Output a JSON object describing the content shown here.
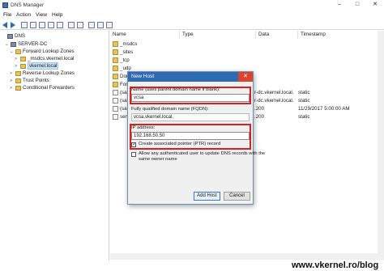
{
  "titlebar": {
    "title": "DNS Manager",
    "minimize": "–",
    "maximize": "□",
    "close": "✕"
  },
  "menu": [
    "File",
    "Action",
    "View",
    "Help"
  ],
  "tree": [
    {
      "label": "DNS",
      "expander": "",
      "icon": "dns-icon"
    },
    {
      "label": "SERVER-DC",
      "expander": "⌄",
      "icon": "server-icon"
    },
    {
      "label": "Forward Lookup Zones",
      "expander": "⌄",
      "icon": "folder-icon"
    },
    {
      "label": "_msdcs.vkernel.local",
      "expander": ">",
      "icon": "zone-icon"
    },
    {
      "label": "vkernel.local",
      "expander": ">",
      "icon": "zone-icon"
    },
    {
      "label": "Reverse Lookup Zones",
      "expander": ">",
      "icon": "folder-icon"
    },
    {
      "label": "Trust Points",
      "expander": ">",
      "icon": "folder-icon"
    },
    {
      "label": "Conditional Forwarders",
      "expander": ">",
      "icon": "folder-icon"
    }
  ],
  "list": {
    "columns": [
      "Name",
      "Type",
      "Data",
      "Timestamp"
    ],
    "rows": [
      {
        "name": "_msdcs",
        "data": "",
        "ts": ""
      },
      {
        "name": "_sites",
        "data": "",
        "ts": ""
      },
      {
        "name": "_tcp",
        "data": "",
        "ts": ""
      },
      {
        "name": "_udp",
        "data": "",
        "ts": ""
      },
      {
        "name": "Dom",
        "data": "",
        "ts": ""
      },
      {
        "name": "Fore",
        "data": "",
        "ts": ""
      },
      {
        "name": "(sam",
        "data": "r-dc.vkernel.local.",
        "ts": "static"
      },
      {
        "name": "(sam",
        "data": "r-dc.vkernel.local.",
        "ts": "static"
      },
      {
        "name": "(sam",
        "data": ".200",
        "ts": "11/29/2017 5:00:00 AM"
      },
      {
        "name": "serv",
        "data": ".200",
        "ts": "static"
      }
    ]
  },
  "dialog": {
    "title": "New Host",
    "close": "✕",
    "name_label": "Name (uses parent domain name if blank):",
    "name_value": "vcsa",
    "fqdn_label": "Fully qualified domain name (FQDN):",
    "fqdn_value": "vcsa.vkernel.local.",
    "ip_label": "IP address:",
    "ip_value": "192.168.50.50",
    "ptr_label": "Create associated pointer (PTR) record",
    "ptr_checked": true,
    "allow_label": "Allow any authenticated user to update DNS records with the",
    "allow_label2": "same owner name",
    "allow_checked": false,
    "add_button": "Add Host",
    "cancel_button": "Cancel"
  },
  "watermark": "www.vkernel.ro/blog",
  "colors": {
    "accent": "#2f6bb3",
    "highlight": "#d32222",
    "close": "#d9432f"
  }
}
